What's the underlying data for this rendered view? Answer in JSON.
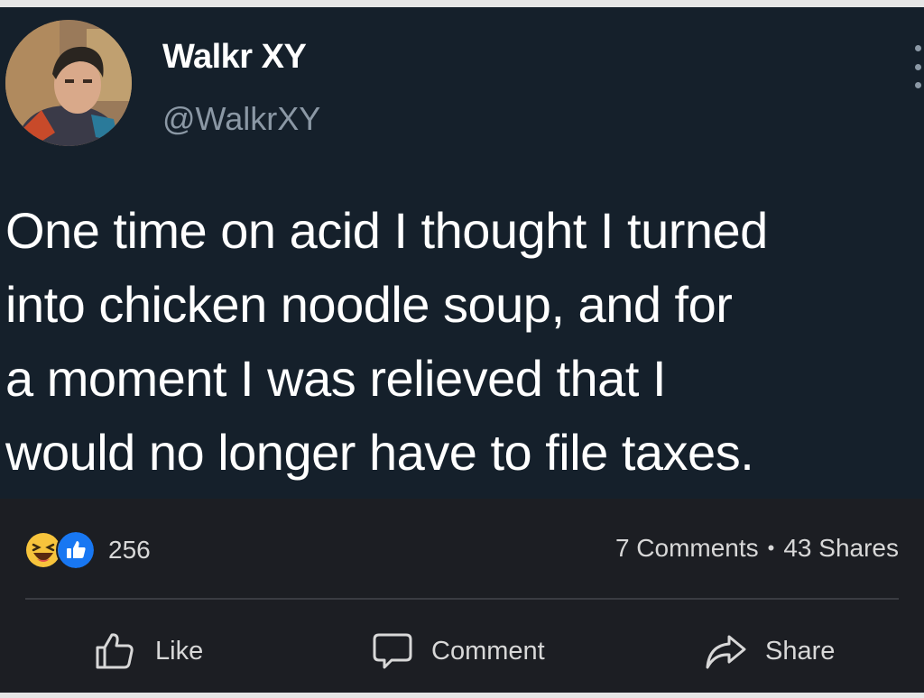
{
  "post": {
    "author_name": "Walkr XY",
    "author_handle": "@WalkrXY",
    "text": "One time on acid I thought I turned\ninto chicken noodle soup, and for\na moment I was relieved that I\nwould no longer have to file taxes."
  },
  "engagement": {
    "reaction_count": "256",
    "comments": "7 Comments",
    "separator": "•",
    "shares": "43 Shares",
    "reaction_icons": [
      "laughing-emoji-icon",
      "thumbs-up-icon"
    ]
  },
  "actions": {
    "like_label": "Like",
    "comment_label": "Comment",
    "share_label": "Share"
  },
  "colors": {
    "tweet_background": "#15202b",
    "facebook_background": "#1c1e23",
    "like_blue": "#1877f2",
    "haha_yellow": "#f7c43c"
  }
}
